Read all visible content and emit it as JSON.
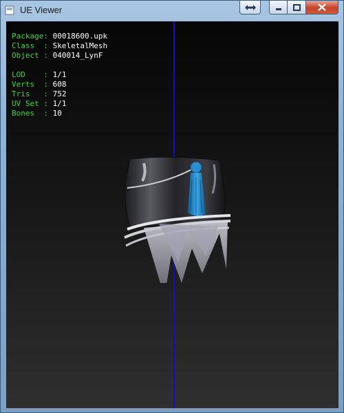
{
  "window": {
    "title": "UE Viewer",
    "icon": "app-icon"
  },
  "titlebar_buttons": [
    "restore-swap-icon",
    "minimize-icon",
    "maximize-icon",
    "close-icon"
  ],
  "info": {
    "package": {
      "label": "Package:",
      "value": "00018600.upk"
    },
    "class": {
      "label": "Class  :",
      "value": "SkeletalMesh"
    },
    "object": {
      "label": "Object :",
      "value": "040014_LynF"
    },
    "lod": {
      "label": "LOD    :",
      "value": "1/1"
    },
    "verts": {
      "label": "Verts  :",
      "value": "608"
    },
    "tris": {
      "label": "Tris   :",
      "value": "752"
    },
    "uvset": {
      "label": "UV Set :",
      "value": "1/1"
    },
    "bones": {
      "label": "Bones  :",
      "value": "10"
    }
  },
  "colors": {
    "label_green": "#3fd13f",
    "value_white": "#ffffff",
    "axis_blue": "#1212b8",
    "tassel_blue": "#2a8fd0"
  }
}
